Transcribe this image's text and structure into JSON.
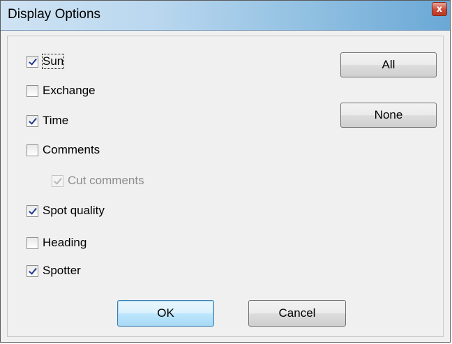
{
  "window": {
    "title": "Display Options",
    "close_glyph": "x"
  },
  "checkboxes": [
    {
      "key": "sun",
      "label": "Sun",
      "checked": true,
      "enabled": true,
      "focused": true
    },
    {
      "key": "exchange",
      "label": "Exchange",
      "checked": false,
      "enabled": true,
      "focused": false
    },
    {
      "key": "time",
      "label": "Time",
      "checked": true,
      "enabled": true,
      "focused": false
    },
    {
      "key": "comments",
      "label": "Comments",
      "checked": false,
      "enabled": true,
      "focused": false
    },
    {
      "key": "cut-comments",
      "label": "Cut comments",
      "checked": true,
      "enabled": false,
      "focused": false
    },
    {
      "key": "spot-quality",
      "label": "Spot quality",
      "checked": true,
      "enabled": true,
      "focused": false
    },
    {
      "key": "heading",
      "label": "Heading",
      "checked": false,
      "enabled": true,
      "focused": false
    },
    {
      "key": "spotter",
      "label": "Spotter",
      "checked": true,
      "enabled": true,
      "focused": false
    }
  ],
  "buttons": {
    "all": "All",
    "none": "None",
    "ok": "OK",
    "cancel": "Cancel"
  },
  "icons": {
    "close": "close-icon",
    "checkmark": "checkmark-icon"
  }
}
